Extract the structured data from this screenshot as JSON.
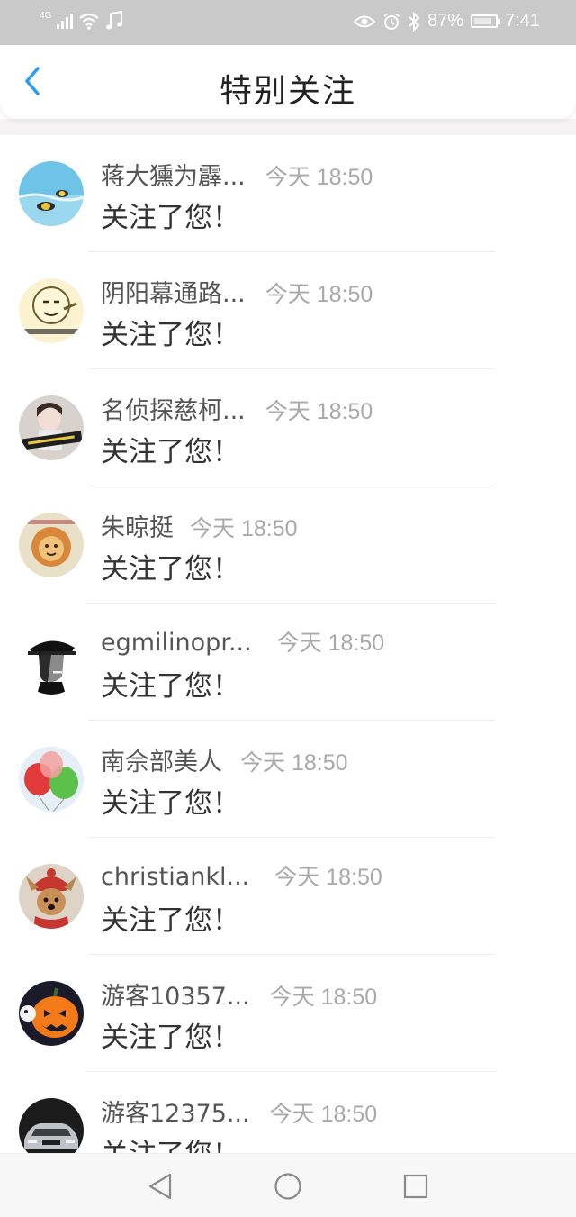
{
  "status_bar": {
    "network_tag": "4G",
    "battery_percent_text": "87%",
    "battery_level": 0.87,
    "time": "7:41",
    "icons": [
      "signal-icon",
      "wifi-icon",
      "music-icon",
      "eye-icon",
      "alarm-icon",
      "bluetooth-icon",
      "battery-icon"
    ]
  },
  "header": {
    "title": "特别关注",
    "back_icon": "chevron-left-icon",
    "accent_color": "#2a9df4"
  },
  "items": [
    {
      "name": "蒋大獯为霹...",
      "time": "今天 18:50",
      "message": "关注了您！",
      "avatar": "beach-fish-avatar"
    },
    {
      "name": "阴阳幕通路...",
      "time": "今天 18:50",
      "message": "关注了您！",
      "avatar": "meme-face-avatar"
    },
    {
      "name": "名侦探慈柯...",
      "time": "今天 18:50",
      "message": "关注了您！",
      "avatar": "anime-girl-avatar"
    },
    {
      "name": "朱晾挺",
      "time": "今天 18:50",
      "message": "关注了您！",
      "avatar": "cartoon-lion-avatar"
    },
    {
      "name": "egmilinopr...",
      "time": "今天 18:50",
      "message": "关注了您！",
      "avatar": "capped-man-avatar"
    },
    {
      "name": "南佘部美人",
      "time": "今天 18:50",
      "message": "关注了您！",
      "avatar": "balloons-avatar"
    },
    {
      "name": "christiankl...",
      "time": "今天 18:50",
      "message": "关注了您！",
      "avatar": "dog-hat-avatar"
    },
    {
      "name": "游客10357...",
      "time": "今天 18:50",
      "message": "关注了您！",
      "avatar": "pumpkin-avatar"
    },
    {
      "name": "游客12375...",
      "time": "今天 18:50",
      "message": "关注了您！",
      "avatar": "car-avatar"
    }
  ],
  "nav_bar": {
    "icons": [
      "back-triangle-icon",
      "home-circle-icon",
      "recents-square-icon"
    ]
  }
}
